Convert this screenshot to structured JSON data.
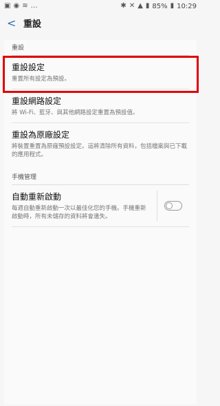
{
  "status": {
    "left_icons": [
      "image-icon",
      "accessibility-icon",
      "wifi-icon",
      "more-icon"
    ],
    "battery_pct": "85%",
    "time": "10:29"
  },
  "appbar": {
    "title": "重設"
  },
  "sections": [
    {
      "header": "重設",
      "items": [
        {
          "title": "重設設定",
          "subtitle": "重置所有設定為預設。"
        },
        {
          "title": "重設網路設定",
          "subtitle": "將 Wi-Fi、藍牙、與其他網路設定重置為預設值。"
        },
        {
          "title": "重設為原廠設定",
          "subtitle": "將裝置重置為原廠預設設定。這將清除所有資料，包括檔案與已下載的應用程式。"
        }
      ]
    },
    {
      "header": "手機管理",
      "items": [
        {
          "title": "自動重新啟動",
          "subtitle": "每週自動重新啟動一次以最佳化您的手機。手機重新啟動時，所有未儲存的資料將會遺失。",
          "toggle": false
        }
      ]
    }
  ]
}
